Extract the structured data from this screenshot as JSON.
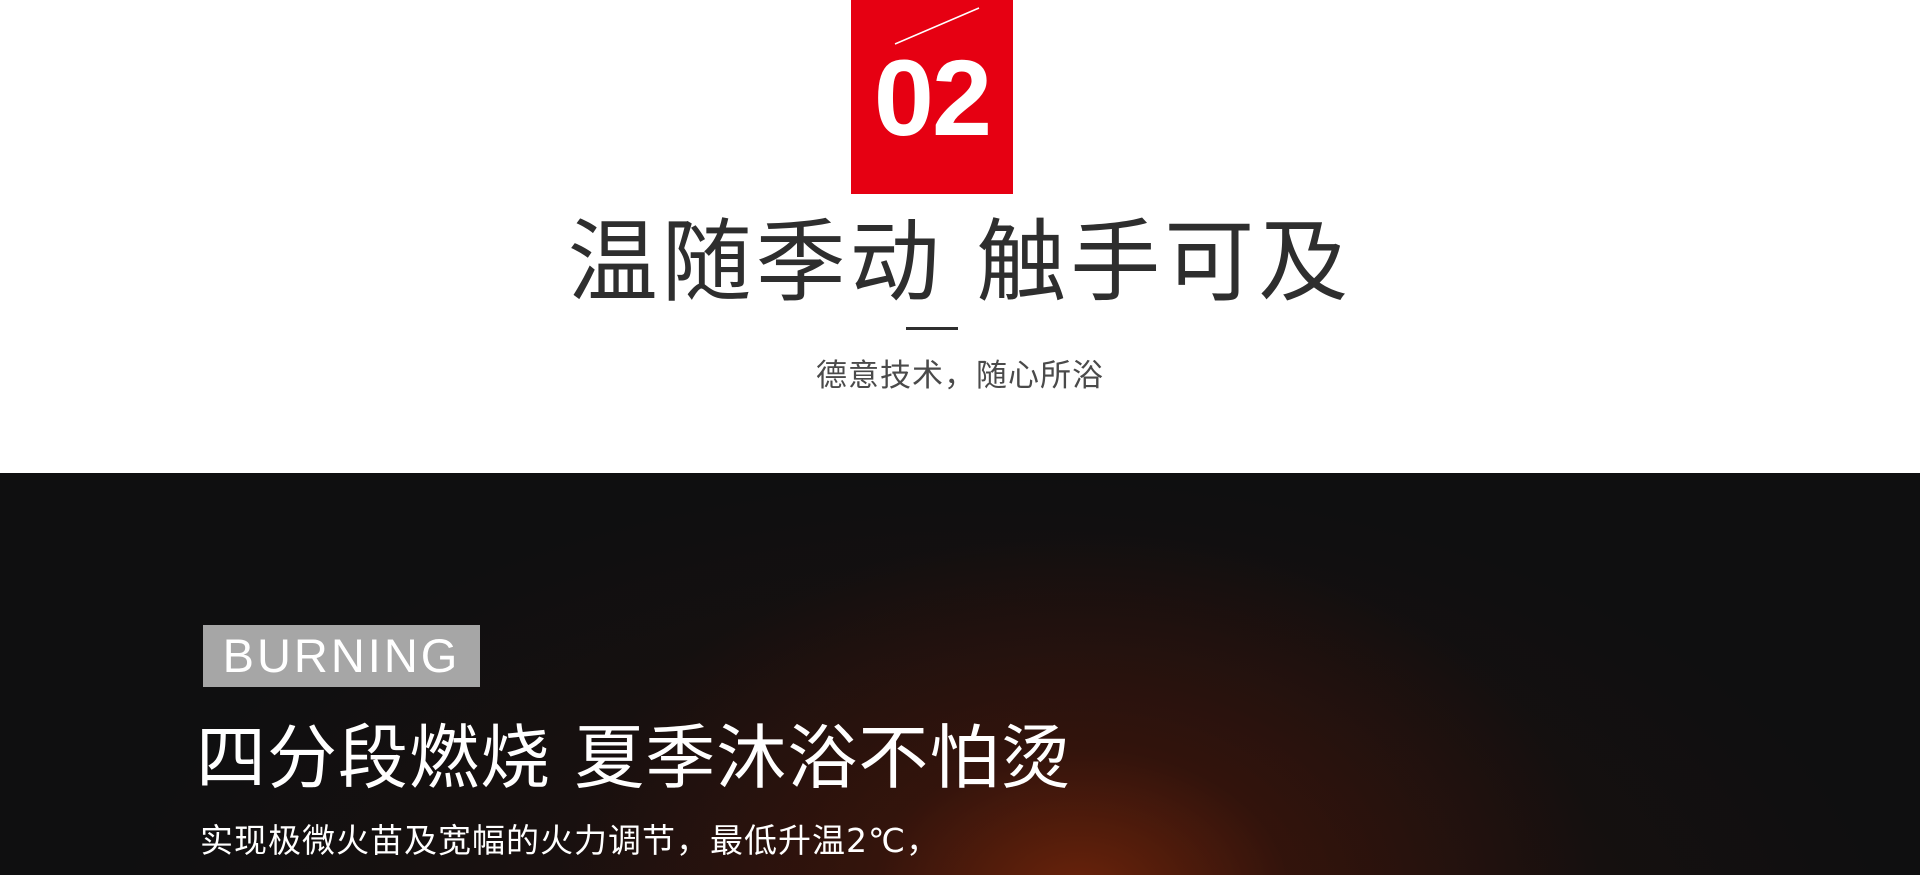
{
  "header": {
    "section_number": "02",
    "title": "温随季动 触手可及",
    "subtitle": "德意技术，随心所浴"
  },
  "feature": {
    "tag": "BURNING",
    "title": "四分段燃烧 夏季沐浴不怕烫",
    "description": "实现极微火苗及宽幅的火力调节，最低升温2℃，"
  },
  "colors": {
    "accent": "#e60012",
    "dark_bg": "#0f0f10",
    "tag_bg": "#a6a6a6",
    "title_text": "#2e2e2e"
  }
}
